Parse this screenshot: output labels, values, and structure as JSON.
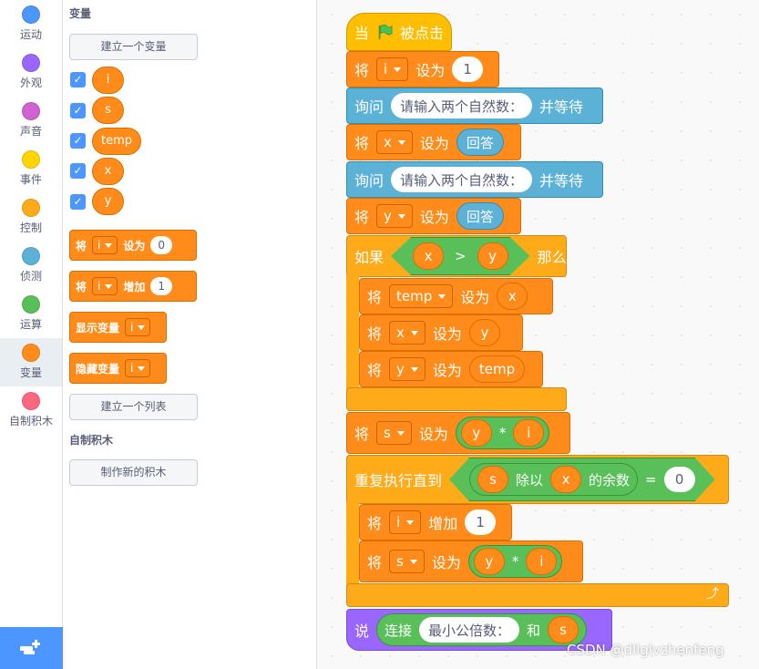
{
  "categories": [
    {
      "label": "运动",
      "color": "#4c97ff"
    },
    {
      "label": "外观",
      "color": "#9966ff"
    },
    {
      "label": "声音",
      "color": "#cf63cf"
    },
    {
      "label": "事件",
      "color": "#ffd500"
    },
    {
      "label": "控制",
      "color": "#ffab19"
    },
    {
      "label": "侦测",
      "color": "#5cb1d6"
    },
    {
      "label": "运算",
      "color": "#59c059"
    },
    {
      "label": "变量",
      "color": "#ff8c1a",
      "selected": true
    },
    {
      "label": "自制积木",
      "color": "#ff6680"
    }
  ],
  "palette": {
    "variables_header": "变量",
    "make_variable": "建立一个变量",
    "variables": [
      "i",
      "s",
      "temp",
      "x",
      "y"
    ],
    "blocks": [
      {
        "op": "将",
        "var": "i",
        "action": "设为",
        "value": "0"
      },
      {
        "op": "将",
        "var": "i",
        "action": "增加",
        "value": "1"
      },
      {
        "op": "显示变量",
        "var": "i"
      },
      {
        "op": "隐藏变量",
        "var": "i"
      }
    ],
    "make_list": "建立一个列表",
    "myblocks_header": "自制积木",
    "make_block": "制作新的积木"
  },
  "script": {
    "hat": {
      "text1": "当",
      "text2": "被点击"
    },
    "b1": {
      "op": "将",
      "var": "i",
      "action": "设为",
      "value": "1"
    },
    "b2": {
      "op": "询问",
      "value": "请输入两个自然数：",
      "tail": "并等待"
    },
    "b3": {
      "op": "将",
      "var": "x",
      "action": "设为",
      "value": "回答"
    },
    "b4": {
      "op": "询问",
      "value": "请输入两个自然数：",
      "tail": "并等待"
    },
    "b5": {
      "op": "将",
      "var": "y",
      "action": "设为",
      "value": "回答"
    },
    "if": {
      "op": "如果",
      "left": "x",
      "cmp": ">",
      "right": "y",
      "then": "那么"
    },
    "if_b1": {
      "op": "将",
      "var": "temp",
      "action": "设为",
      "value": "x"
    },
    "if_b2": {
      "op": "将",
      "var": "x",
      "action": "设为",
      "value": "y"
    },
    "if_b3": {
      "op": "将",
      "var": "y",
      "action": "设为",
      "value": "temp"
    },
    "b6": {
      "op": "将",
      "var": "s",
      "action": "设为",
      "left": "y",
      "mul": "*",
      "right": "i"
    },
    "repeat": {
      "op": "重复执行直到",
      "left": "s",
      "mod": "除以",
      "right": "x",
      "rem": "的余数",
      "eq": "=",
      "value": "0"
    },
    "rep_b1": {
      "op": "将",
      "var": "i",
      "action": "增加",
      "value": "1"
    },
    "rep_b2": {
      "op": "将",
      "var": "s",
      "action": "设为",
      "left": "y",
      "mul": "*",
      "right": "i"
    },
    "say": {
      "op": "说",
      "join": "连接",
      "value": "最小公倍数：",
      "and": "和",
      "var": "s"
    }
  },
  "watermark": "CSDN @dllglvzhenfeng"
}
